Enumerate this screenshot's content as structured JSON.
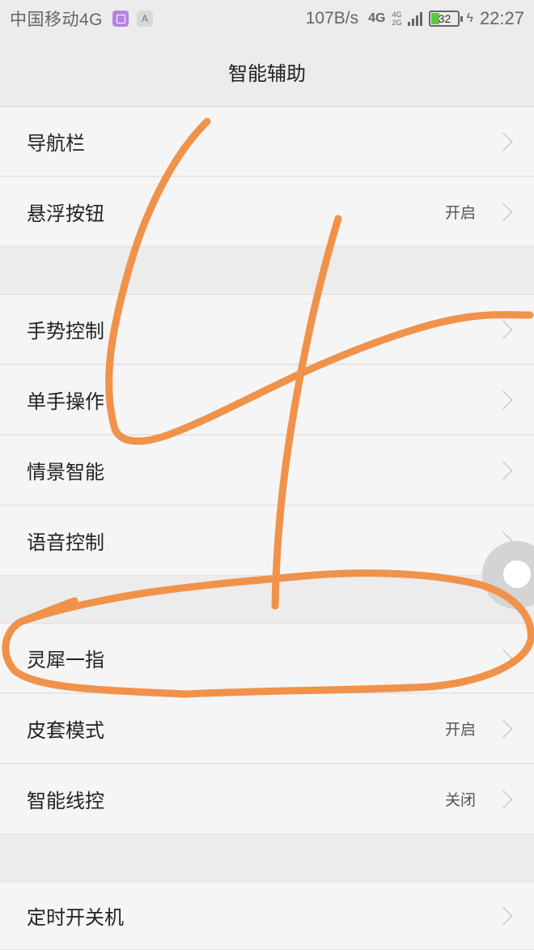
{
  "status_bar": {
    "carrier": "中国移动4G",
    "notif_letter": "A",
    "speed": "107B/s",
    "net": "4G",
    "net_small_top": "4G",
    "net_small_bottom": "2G",
    "battery": "32",
    "time": "22:27"
  },
  "header": {
    "title": "智能辅助"
  },
  "rows": [
    {
      "label": "导航栏",
      "value": ""
    },
    {
      "label": "悬浮按钮",
      "value": "开启"
    },
    {
      "label": "手势控制",
      "value": ""
    },
    {
      "label": "单手操作",
      "value": ""
    },
    {
      "label": "情景智能",
      "value": ""
    },
    {
      "label": "语音控制",
      "value": ""
    },
    {
      "label": "灵犀一指",
      "value": ""
    },
    {
      "label": "皮套模式",
      "value": "开启"
    },
    {
      "label": "智能线控",
      "value": "关闭"
    },
    {
      "label": "定时开关机",
      "value": ""
    }
  ],
  "colors": {
    "annotation": "#f0924a",
    "background": "#ececec",
    "row": "#f5f5f5"
  }
}
